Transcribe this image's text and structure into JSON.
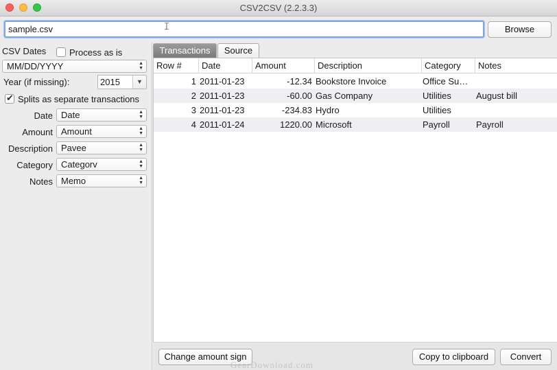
{
  "window": {
    "title": "CSV2CSV (2.2.3.3)"
  },
  "file": {
    "path": "sample.csv",
    "browse_label": "Browse"
  },
  "options": {
    "csv_dates_label": "CSV Dates",
    "process_as_is_label": "Process as is",
    "process_as_is_checked": false,
    "date_format": "MM/DD/YYYY",
    "year_label": "Year (if missing):",
    "year_value": "2015",
    "splits_label": "Splits as separate transactions",
    "splits_checked": true
  },
  "mappings": [
    {
      "label": "Date",
      "value": "Date"
    },
    {
      "label": "Amount",
      "value": "Amount"
    },
    {
      "label": "Description",
      "value": "Pavee"
    },
    {
      "label": "Category",
      "value": "Categorv"
    },
    {
      "label": "Notes",
      "value": "Memo"
    }
  ],
  "tabs": [
    {
      "label": "Transactions",
      "active": true
    },
    {
      "label": "Source",
      "active": false
    }
  ],
  "table": {
    "columns": [
      "Row #",
      "Date",
      "Amount",
      "Description",
      "Category",
      "Notes"
    ],
    "rows": [
      [
        "1",
        "2011-01-23",
        "-12.34",
        "Bookstore Invoice",
        "Office Su…",
        ""
      ],
      [
        "2",
        "2011-01-23",
        "-60.00",
        "Gas Company",
        "Utilities",
        "August bill"
      ],
      [
        "3",
        "2011-01-23",
        "-234.83",
        "Hydro",
        "Utilities",
        ""
      ],
      [
        "4",
        "2011-01-24",
        "1220.00",
        "Microsoft",
        "Payroll",
        "Payroll"
      ]
    ]
  },
  "actions": {
    "change_sign_label": "Change amount sign",
    "copy_label": "Copy to clipboard",
    "convert_label": "Convert"
  },
  "watermark": "GearDownload.com",
  "colors": {
    "active_tab": "#8a8a8a",
    "focus_ring": "#7ea6e0"
  }
}
